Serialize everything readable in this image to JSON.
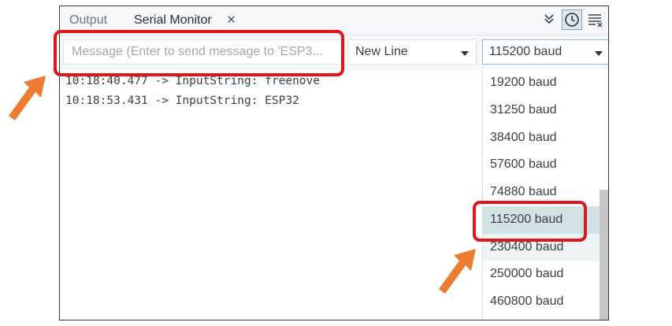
{
  "tabs": {
    "output_label": "Output",
    "serial_monitor_label": "Serial Monitor",
    "close_glyph": "×"
  },
  "toolbar": {
    "icons": [
      "autoscroll-icon",
      "timestamp-icon",
      "clear-output-icon"
    ]
  },
  "message_input": {
    "placeholder": "Message (Enter to send message to 'ESP3..."
  },
  "line_ending": {
    "selected": "New Line"
  },
  "baud_rate": {
    "selected": "115200 baud",
    "options": [
      "19200 baud",
      "31250 baud",
      "38400 baud",
      "57600 baud",
      "74880 baud",
      "115200 baud",
      "230400 baud",
      "250000 baud",
      "460800 baud"
    ]
  },
  "serial_output": {
    "lines": [
      "10:18:40.477 -> InputString: freenove",
      "10:18:53.431 -> InputString: ESP32"
    ]
  },
  "colors": {
    "highlight": "#e0161a",
    "arrow": "#ec7c30",
    "selected_option_bg": "#d2e1e3"
  }
}
